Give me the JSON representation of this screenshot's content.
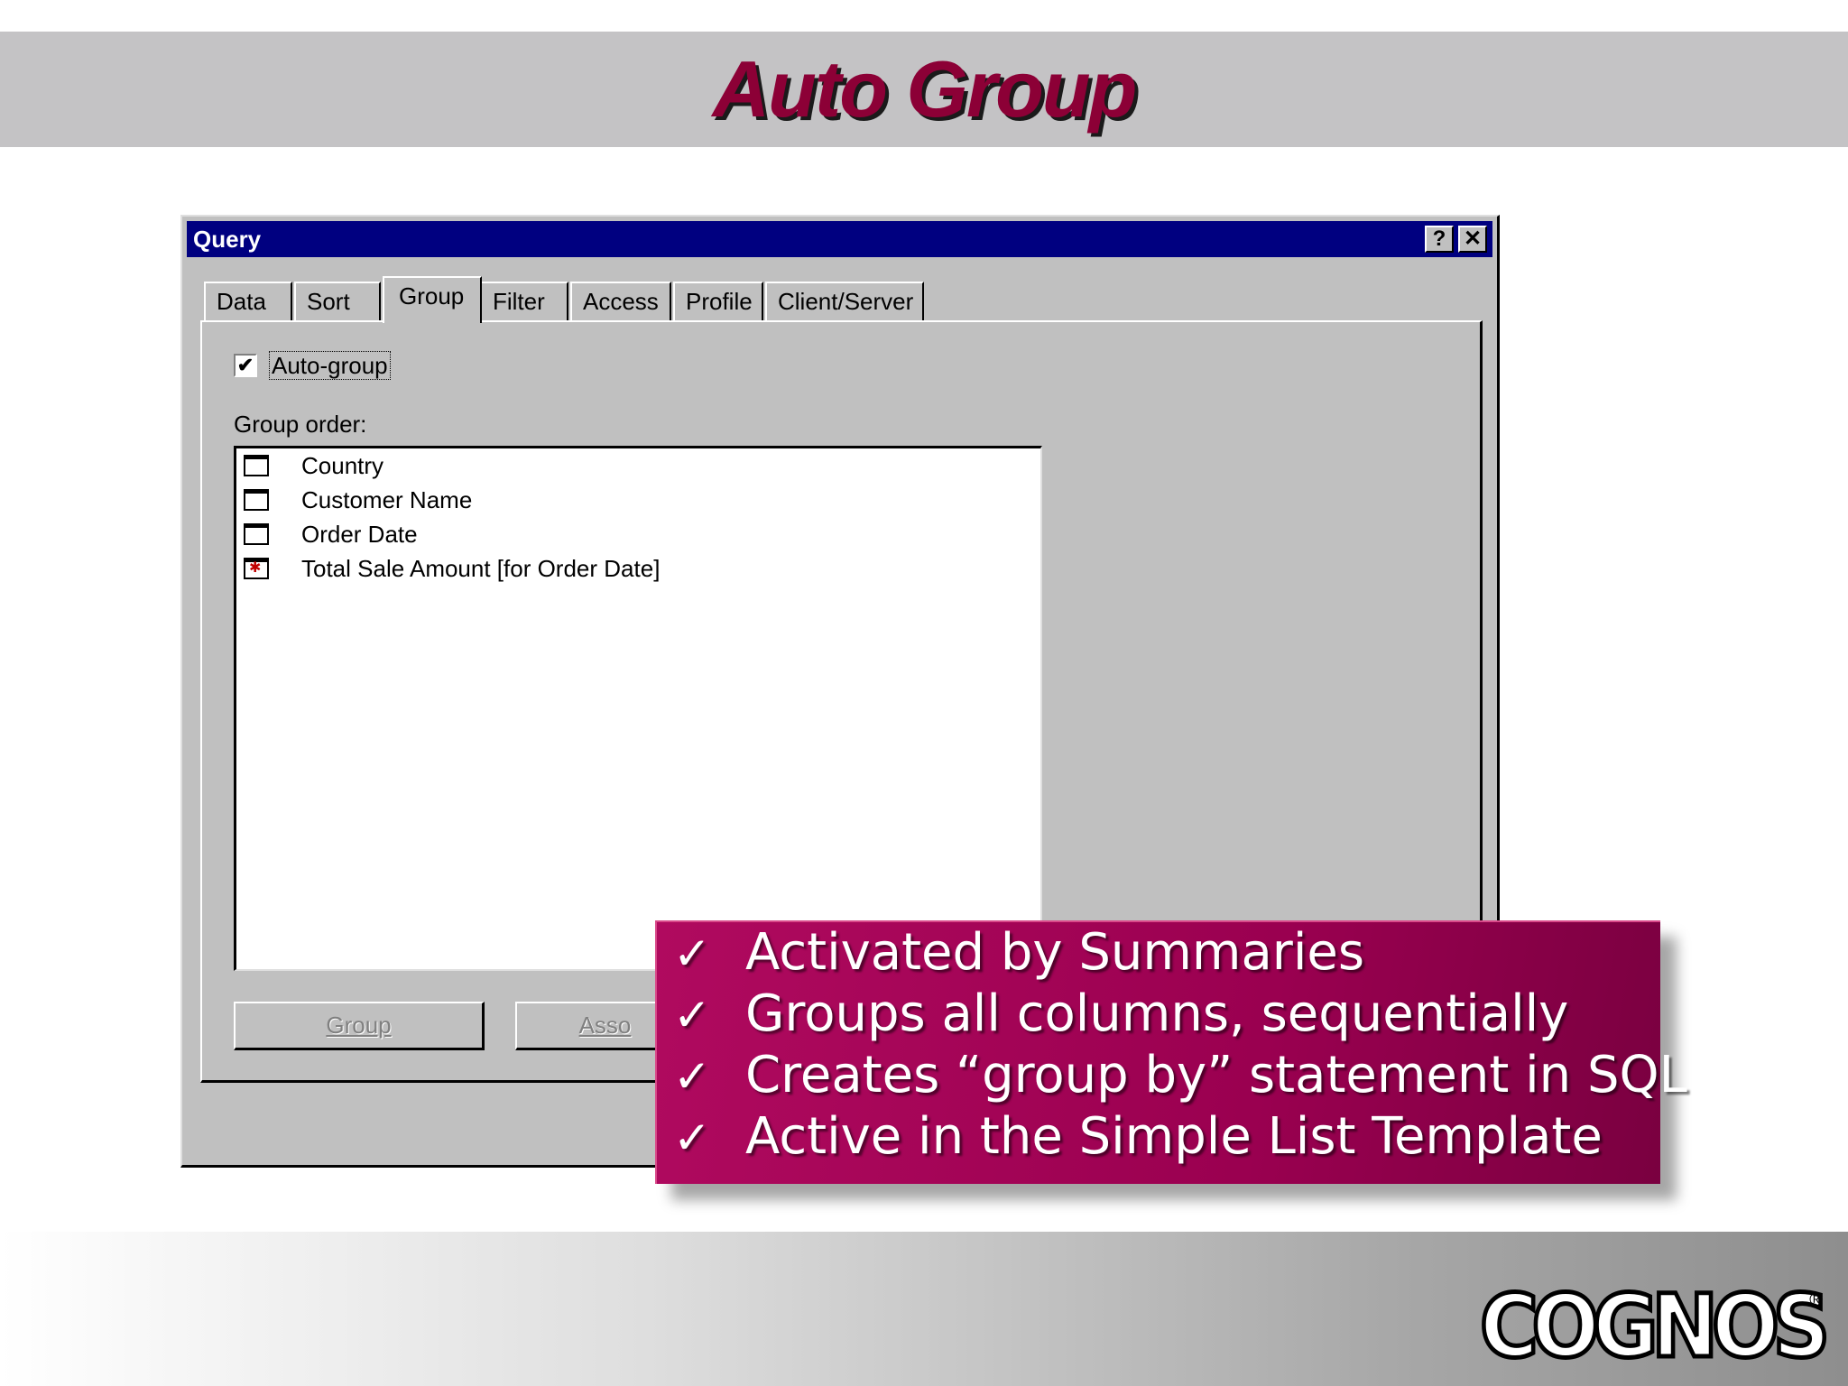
{
  "slide": {
    "title": "Auto Group"
  },
  "dialog": {
    "title": "Query",
    "help_button": "?",
    "close_button": "✕",
    "tabs": [
      {
        "label": "Data"
      },
      {
        "label": "Sort"
      },
      {
        "label": "Group",
        "active": true
      },
      {
        "label": "Filter"
      },
      {
        "label": "Access"
      },
      {
        "label": "Profile"
      },
      {
        "label": "Client/Server"
      }
    ],
    "auto_group": {
      "label": "Auto-group",
      "checked": true,
      "checkmark": "✔"
    },
    "group_order_label": "Group order:",
    "group_order_items": [
      {
        "label": "Country",
        "icon": "column-icon"
      },
      {
        "label": "Customer Name",
        "icon": "column-icon"
      },
      {
        "label": "Order Date",
        "icon": "column-icon"
      },
      {
        "label": "Total Sale Amount [for Order Date]",
        "icon": "summary-column-icon"
      }
    ],
    "buttons": {
      "group": "Group",
      "associate": "Asso"
    }
  },
  "callout": {
    "check_glyph": "✓",
    "items": [
      "Activated by Summaries",
      "Groups all columns, sequentially",
      "Creates “group by” statement in SQL",
      "Active in the Simple List Template"
    ]
  },
  "logo": {
    "text": "COGNOS",
    "registered": "®"
  },
  "colors": {
    "title": "#8c0036",
    "titlebar": "#000080",
    "callout": "#9a0050"
  }
}
